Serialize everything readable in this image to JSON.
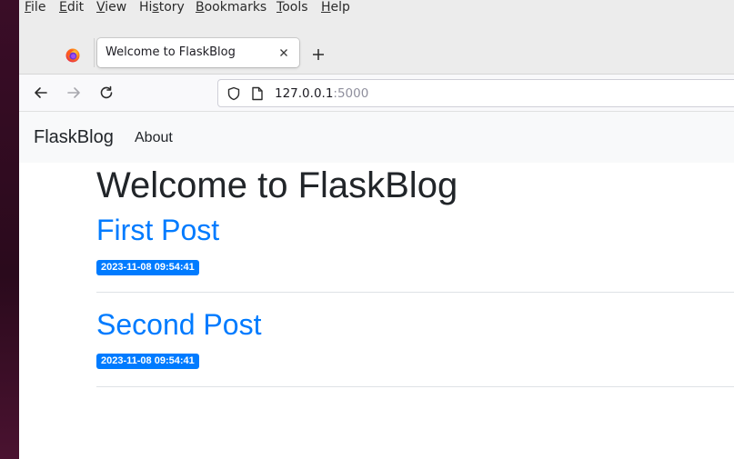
{
  "menubar": {
    "items": [
      "File",
      "Edit",
      "View",
      "History",
      "Bookmarks",
      "Tools",
      "Help"
    ],
    "accelerators": [
      "F",
      "E",
      "V",
      "s",
      "B",
      "T",
      "H"
    ]
  },
  "browser": {
    "tab_title": "Welcome to FlaskBlog",
    "url_host": "127.0.0.1",
    "url_port": ":5000",
    "icons": {
      "app": "firefox-icon",
      "tab_close": "close-icon",
      "new_tab": "plus-icon",
      "back": "arrow-left-icon",
      "forward": "arrow-right-icon",
      "reload": "reload-icon",
      "shield": "shield-icon",
      "page": "page-icon"
    }
  },
  "site": {
    "brand": "FlaskBlog",
    "nav_about": "About",
    "page_title": "Welcome to FlaskBlog",
    "posts": [
      {
        "title": "First Post",
        "created": "2023-11-08 09:54:41"
      },
      {
        "title": "Second Post",
        "created": "2023-11-08 09:54:41"
      }
    ]
  },
  "colors": {
    "link": "#007bff",
    "badge_bg": "#007bff",
    "navbar_bg": "#f8f9fa",
    "text": "#212529"
  }
}
